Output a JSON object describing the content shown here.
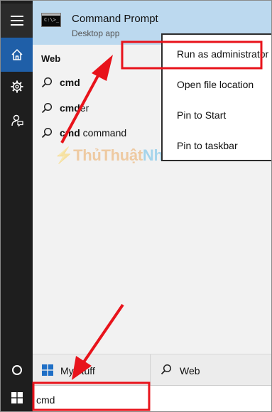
{
  "best_match": {
    "title": "Command Prompt",
    "subtitle": "Desktop app",
    "icon": "command-prompt-icon",
    "icon_prompt": "C:\\>_"
  },
  "results": {
    "section_label": "Web",
    "items": [
      {
        "bold": "cmd",
        "rest": "",
        "icon": "search-icon"
      },
      {
        "bold": "cmd",
        "rest": "er",
        "icon": "search-icon"
      },
      {
        "bold": "cmd",
        "rest": " command",
        "icon": "search-icon"
      }
    ]
  },
  "context_menu": {
    "items": [
      {
        "label": "Run as administrator",
        "highlighted": true
      },
      {
        "label": "Open file location",
        "highlighted": false
      },
      {
        "label": "Pin to Start",
        "highlighted": false
      },
      {
        "label": "Pin to taskbar",
        "highlighted": false
      }
    ]
  },
  "watermark": {
    "part1": "ThủThuật",
    "part2": "Nhanh.Com"
  },
  "filters": {
    "my_stuff": "My stuff",
    "web": "Web"
  },
  "search": {
    "value": "cmd"
  },
  "sidebar": {
    "items": [
      "hamburger-menu-icon",
      "home-icon",
      "settings-gear-icon",
      "feedback-icon",
      "cortana-circle-icon",
      "windows-start-icon"
    ]
  },
  "colors": {
    "sidebar_bg": "#1e1e1e",
    "sidebar_selected": "#1f5fa8",
    "best_match_bg": "#bcd9ef",
    "panel_bg": "#f2f2f2",
    "annotation_red": "#e8131b"
  }
}
